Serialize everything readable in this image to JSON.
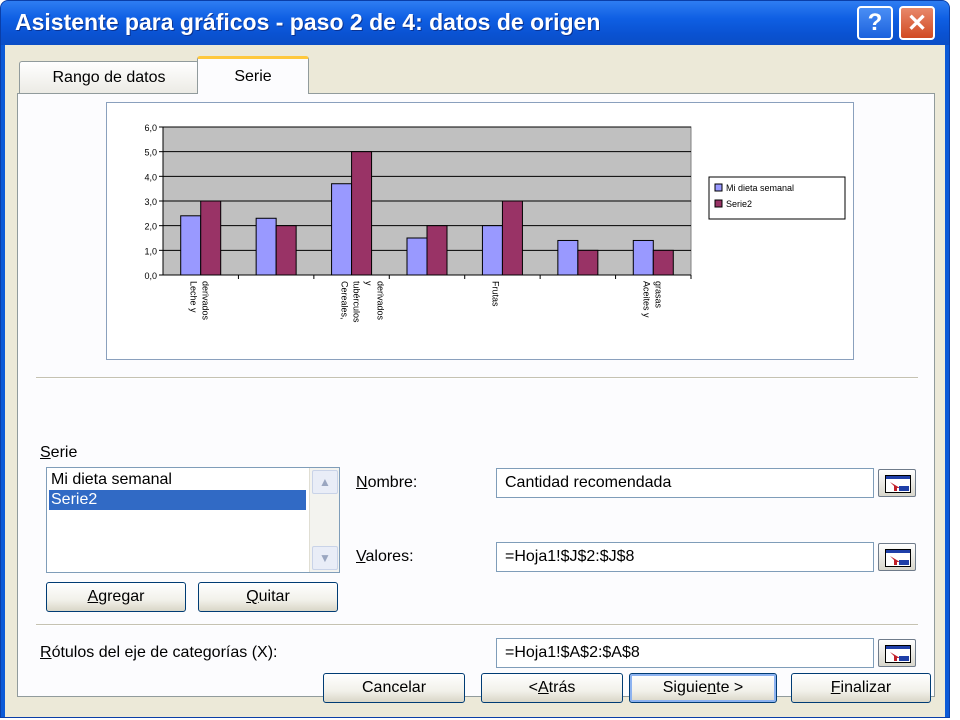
{
  "window": {
    "title": "Asistente para gráficos - paso 2 de 4: datos de origen",
    "help_label": "?",
    "close_label": "✕"
  },
  "tabs": [
    {
      "label": "Rango de datos",
      "active": false
    },
    {
      "label": "Serie",
      "active": true
    }
  ],
  "chart_data": {
    "type": "bar",
    "categories": [
      "Leche y derivados",
      "",
      "Cereales, tubérculos y derivados",
      "",
      "Frutas",
      "",
      "Aceites y grasas"
    ],
    "category_labels": [
      [
        "Leche y",
        "derivados"
      ],
      [],
      [
        "Cereales,",
        "tubérculos",
        "y",
        "derivados"
      ],
      [],
      [
        "Frutas"
      ],
      [],
      [
        "Aceites y",
        "grasas"
      ]
    ],
    "series": [
      {
        "name": "Mi dieta semanal",
        "values": [
          2.4,
          2.3,
          3.7,
          1.5,
          2.0,
          1.4,
          1.4
        ],
        "color": "#9999ff"
      },
      {
        "name": "Serie2",
        "values": [
          3.0,
          2.0,
          5.0,
          2.0,
          3.0,
          1.0,
          1.0
        ],
        "color": "#993366"
      }
    ],
    "yticks": [
      "0,0",
      "1,0",
      "2,0",
      "3,0",
      "4,0",
      "5,0",
      "6,0"
    ],
    "ylim": [
      0,
      6
    ],
    "grid": true,
    "plot_background": "#c0c0c0",
    "legend": "right"
  },
  "serie": {
    "label_prefix": "",
    "label_underline": "S",
    "label_rest": "erie",
    "items": [
      "Mi dieta semanal",
      "Serie2"
    ],
    "selected_index": 1
  },
  "buttons": {
    "agregar_underline": "A",
    "agregar_rest": "gregar",
    "quitar_underline": "Q",
    "quitar_rest": "uitar"
  },
  "nombre": {
    "label_underline": "N",
    "label_rest": "ombre:",
    "value": "Cantidad recomendada"
  },
  "valores": {
    "label_underline": "V",
    "label_rest": "alores:",
    "value": "=Hoja1!$J$2:$J$8"
  },
  "rotulos": {
    "label_underline": "R",
    "label_rest": "ótulos del eje de categorías (X):",
    "value": "=Hoja1!$A$2:$A$8"
  },
  "footer": {
    "cancel_label": "Cancelar",
    "back_prefix": "< ",
    "back_underline": "A",
    "back_rest": "trás",
    "next_prefix": "Siguie",
    "next_underline": "n",
    "next_rest": "te >",
    "finish_underline": "F",
    "finish_rest": "inalizar"
  }
}
